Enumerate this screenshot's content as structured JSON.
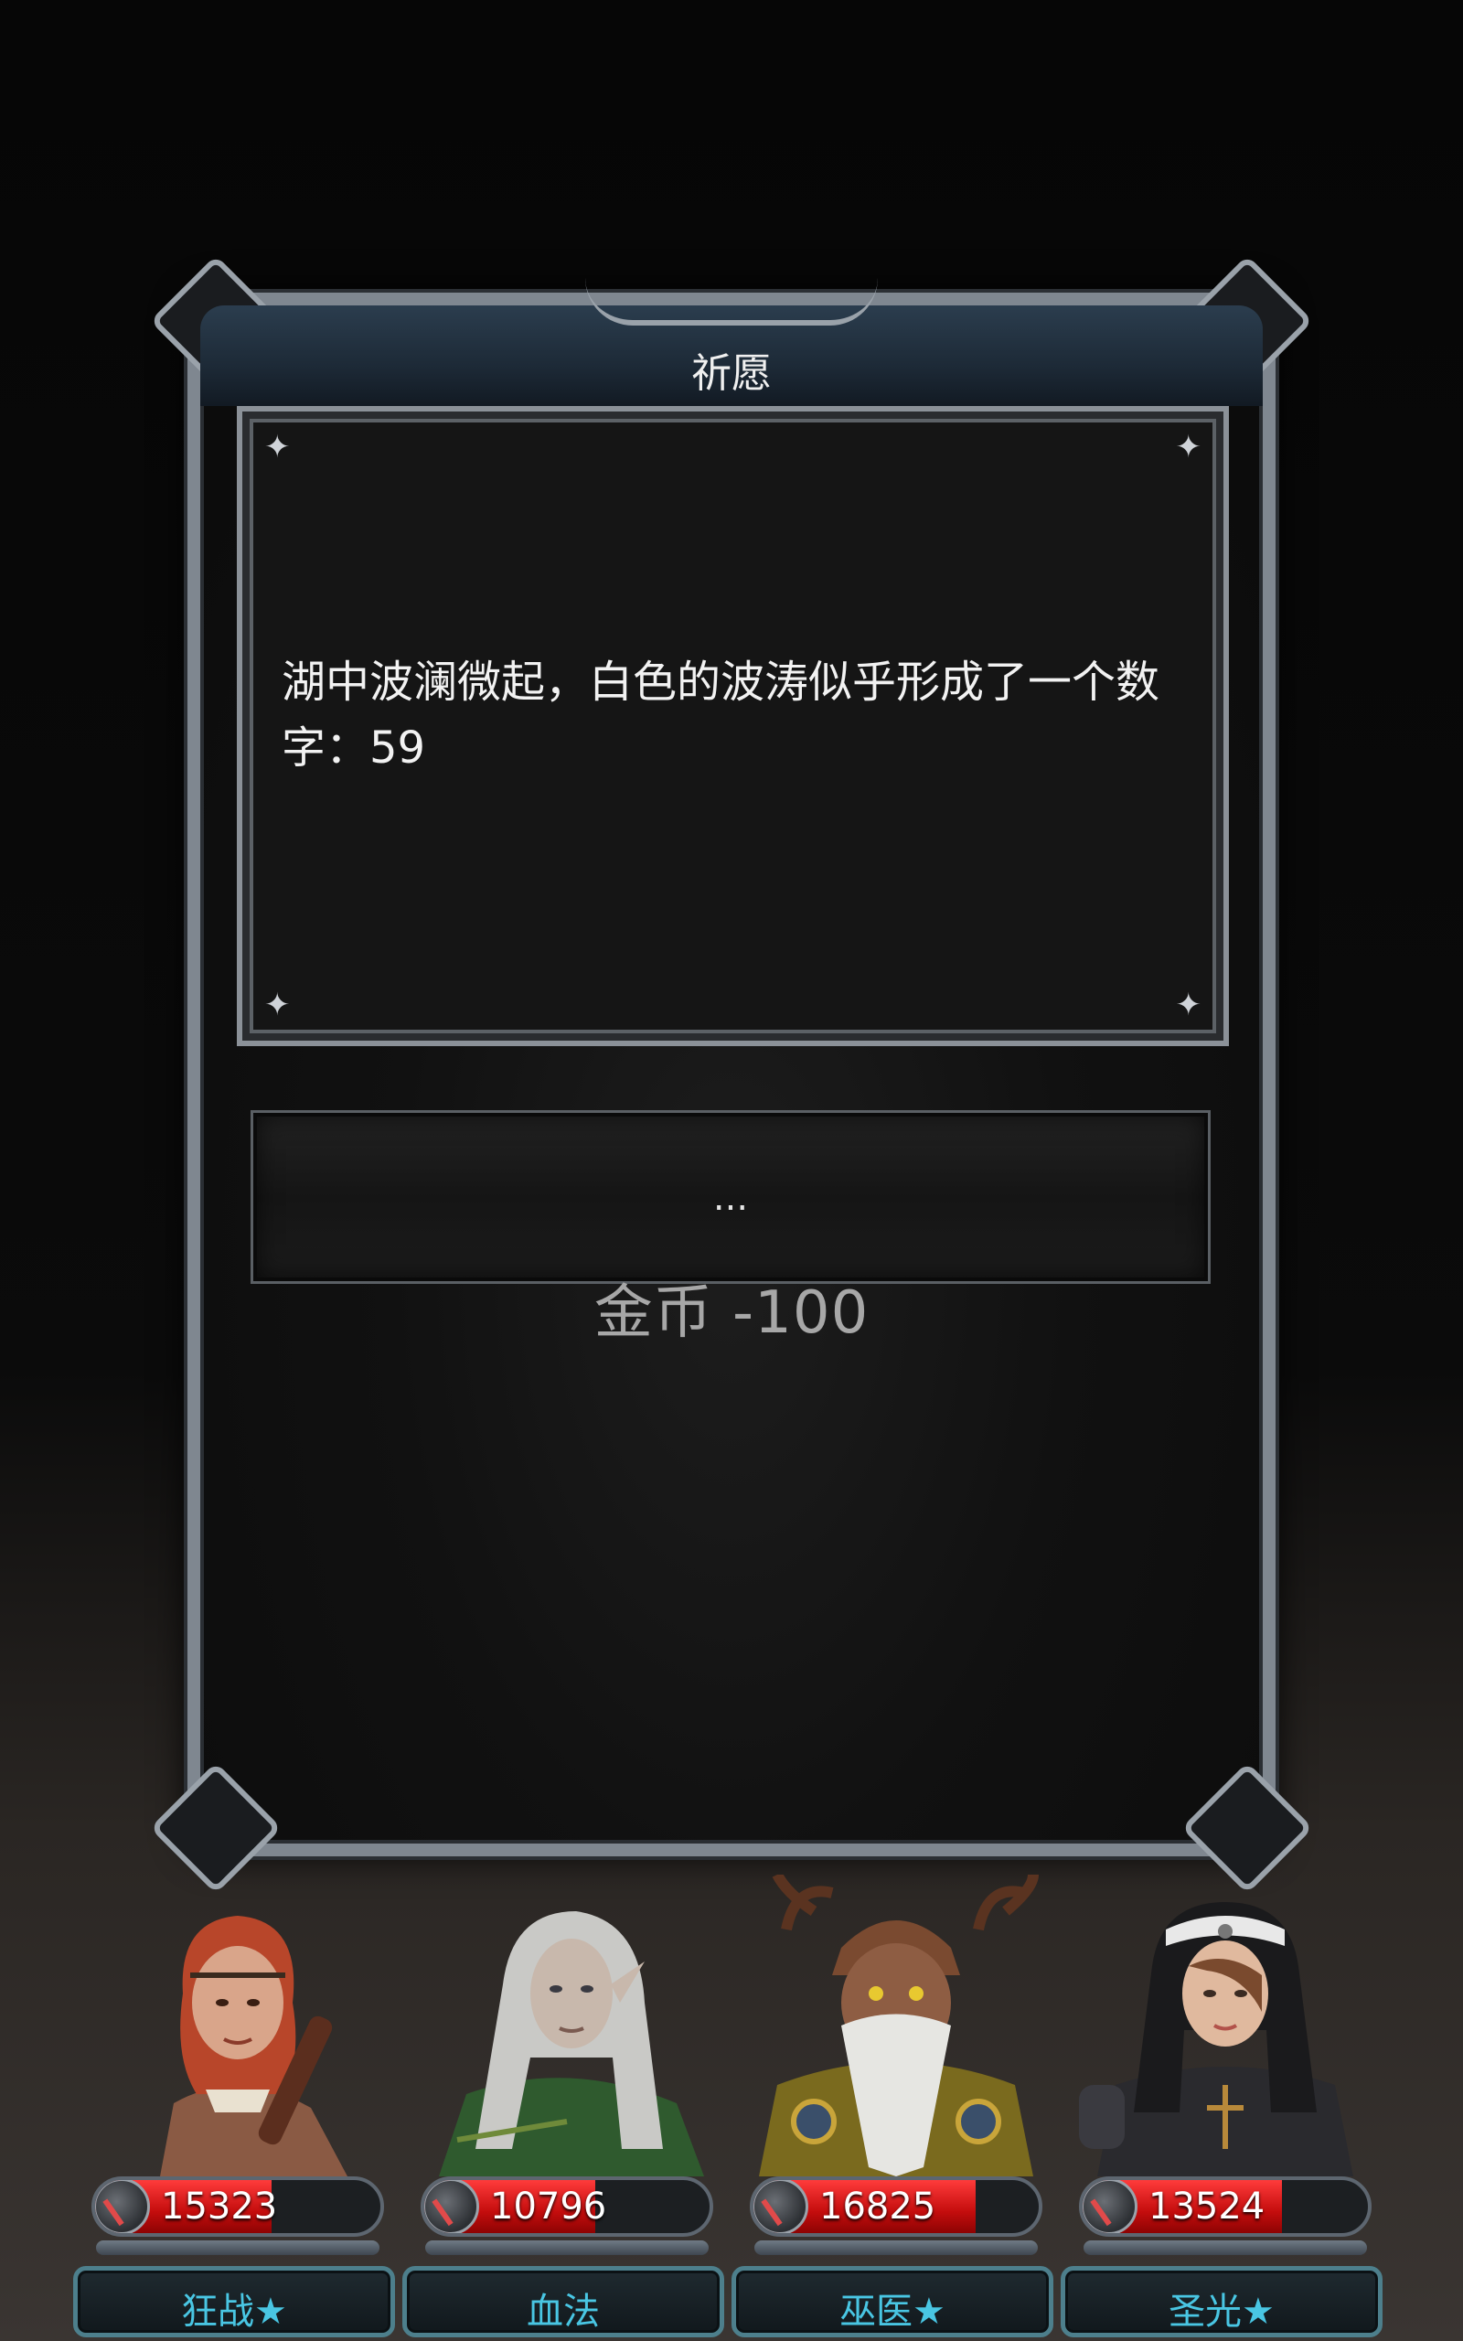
{
  "dialog": {
    "title": "祈愿",
    "message": "湖中波澜微起，白色的波涛似乎形成了一个数字：59",
    "choice_label": "...",
    "cost_text": "金币 -100"
  },
  "heroes": [
    {
      "name": "狂战★",
      "hp": "15323",
      "hp_fill": 0.62,
      "portrait_desc": "red-haired-warrior"
    },
    {
      "name": "血法",
      "hp": "10796",
      "hp_fill": 0.6,
      "portrait_desc": "white-haired-elf-mage"
    },
    {
      "name": "巫医★",
      "hp": "16825",
      "hp_fill": 0.78,
      "portrait_desc": "antlered-druid"
    },
    {
      "name": "圣光★",
      "hp": "13524",
      "hp_fill": 0.7,
      "portrait_desc": "hooded-nun"
    }
  ],
  "colors": {
    "hp_red": "#c40d0d",
    "name_cyan": "#49c6e3",
    "frame_silver": "#7f8790",
    "title_blue": "#1d2a37"
  },
  "icons": {
    "hp": "sword-emblem-icon",
    "corner": "sparkle-icon"
  }
}
